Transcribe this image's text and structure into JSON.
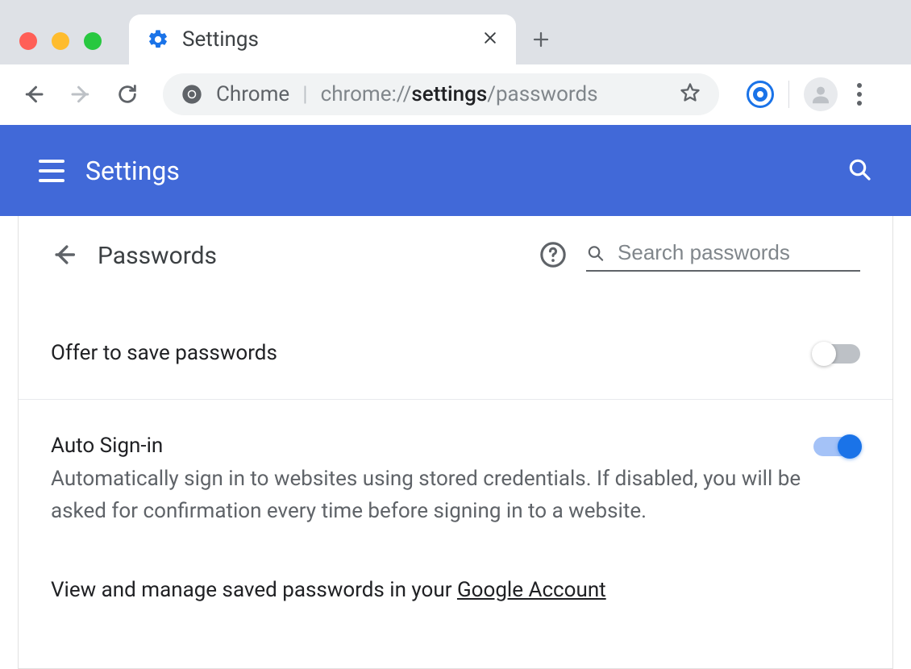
{
  "tabs": [
    {
      "title": "Settings"
    }
  ],
  "omnibox": {
    "chip": "Chrome",
    "url_prefix": "chrome://",
    "url_bold": "settings",
    "url_suffix": "/passwords"
  },
  "settings_bar": {
    "title": "Settings"
  },
  "page": {
    "title": "Passwords",
    "search_placeholder": "Search passwords",
    "rows": {
      "offer_save": {
        "title": "Offer to save passwords",
        "on": false
      },
      "auto_signin": {
        "title": "Auto Sign-in",
        "desc": "Automatically sign in to websites using stored credentials. If disabled, you will be asked for confirmation every time before signing in to a website.",
        "on": true
      },
      "manage_link": {
        "prefix": "View and manage saved passwords in your ",
        "link_text": "Google Account"
      }
    }
  }
}
